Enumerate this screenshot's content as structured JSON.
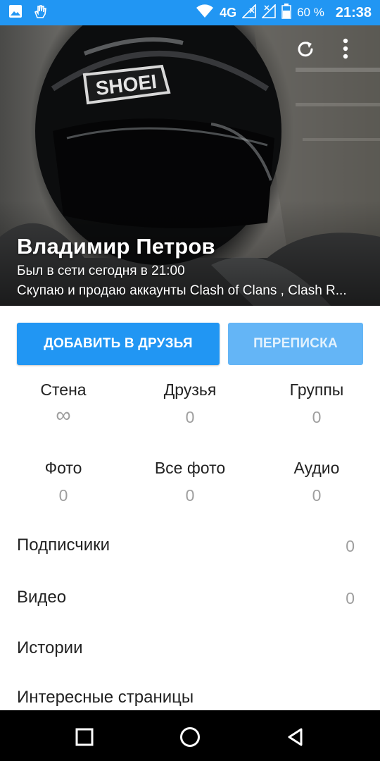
{
  "status_bar": {
    "network": "4G",
    "battery": "60 %",
    "time": "21:38"
  },
  "profile": {
    "name": "Владимир Петров",
    "status": "Был в сети сегодня в 21:00",
    "about": "Скупаю и продаю аккаунты Clash of Clans , Clash R...",
    "cover_icon": "refresh-icon"
  },
  "actions": {
    "add_friend": "ДОБАВИТЬ В ДРУЗЬЯ",
    "messages": "ПЕРЕПИСКА"
  },
  "counters": [
    {
      "label": "Стена",
      "value": "∞"
    },
    {
      "label": "Друзья",
      "value": "0"
    },
    {
      "label": "Группы",
      "value": "0"
    },
    {
      "label": "Фото",
      "value": "0"
    },
    {
      "label": "Все фото",
      "value": "0"
    },
    {
      "label": "Аудио",
      "value": "0"
    }
  ],
  "rows": [
    {
      "label": "Подписчики",
      "value": "0"
    },
    {
      "label": "Видео",
      "value": "0"
    },
    {
      "label": "Истории",
      "value": ""
    },
    {
      "label": "Интересные страницы",
      "value": ""
    }
  ],
  "colors": {
    "accent": "#2196f3",
    "accent_light": "#64b5f6",
    "muted": "#9e9e9e"
  }
}
